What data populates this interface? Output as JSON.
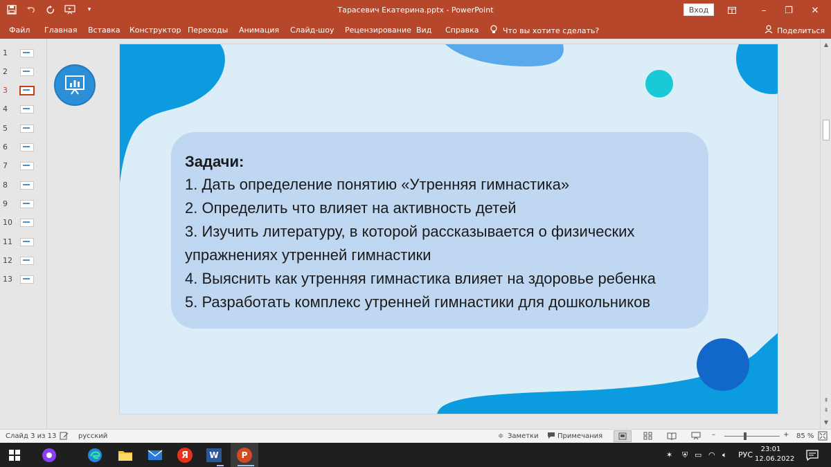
{
  "titlebar": {
    "title": "Тарасевич Екатерина.pptx  -  PowerPoint",
    "signin_label": "Вход",
    "qat": {
      "save_icon": "save-icon",
      "undo_icon": "undo-icon",
      "redo_icon": "redo-icon",
      "present_icon": "present-from-start-icon",
      "customize_icon": "chevron-down-icon"
    },
    "controls": {
      "ribbon_display": "ribbon-display-icon",
      "minimize": "–",
      "restore": "❐",
      "close": "✕"
    }
  },
  "ribbon": {
    "tabs": [
      "Файл",
      "Главная",
      "Вставка",
      "Конструктор",
      "Переходы",
      "Анимация",
      "Слайд-шоу",
      "Рецензирование",
      "Вид",
      "Справка"
    ],
    "tell_me": "Что вы хотите сделать?",
    "share": "Поделиться"
  },
  "thumbnails": {
    "numbers": [
      "1",
      "2",
      "3",
      "4",
      "5",
      "6",
      "7",
      "8",
      "9",
      "10",
      "11",
      "12",
      "13"
    ],
    "active_index": 3
  },
  "slide": {
    "title": "Задачи:",
    "items": [
      "1. Дать определение понятию «Утренняя гимнастика»",
      "2. Определить что влияет на активность детей",
      "3. Изучить литературу, в которой рассказывается о физических",
      "упражнениях утренней гимнастики",
      "4. Выяснить как утренняя гимнастика влияет на здоровье ребенка",
      "5. Разработать комплекс утренней гимнастики для дошкольников"
    ],
    "colors": {
      "background": "#dbedf6",
      "box": "#bfd7f1",
      "blob": "#0d9be0",
      "light_blob": "#5aa9ec",
      "teal": "#19c9d8",
      "dark_circle": "#1168c8"
    }
  },
  "statusbar": {
    "slide_info": "Слайд 3 из 13",
    "language": "русский",
    "notes": "Заметки",
    "comments": "Примечания",
    "zoom_minus": "–",
    "zoom_plus": "+",
    "zoom": "85 %"
  },
  "taskbar": {
    "yandex_label": "Я",
    "word_label": "W",
    "ppt_label": "P",
    "lang": "РУС",
    "time": "23:01",
    "date": "12.06.2022"
  }
}
